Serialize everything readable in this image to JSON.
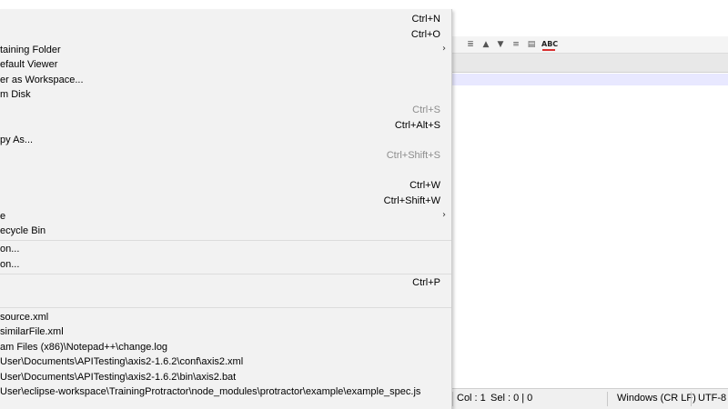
{
  "file_menu": {
    "items": [
      {
        "label": "",
        "shortcut": "Ctrl+N"
      },
      {
        "label": "",
        "shortcut": "Ctrl+O"
      },
      {
        "label": "taining Folder",
        "arrow": "›"
      },
      {
        "label": "efault Viewer"
      },
      {
        "label": "er as Workspace..."
      },
      {
        "label": "m Disk"
      },
      {
        "label": "",
        "shortcut": "Ctrl+S"
      },
      {
        "label": "",
        "shortcut": "Ctrl+Alt+S"
      },
      {
        "label": "py As..."
      },
      {
        "label": "",
        "shortcut": "Ctrl+Shift+S"
      },
      {
        "label": "",
        "shortcut": "Ctrl+W"
      },
      {
        "label": "",
        "shortcut": "Ctrl+Shift+W"
      },
      {
        "label": "e",
        "arrow": "›"
      },
      {
        "label": "ecycle Bin"
      },
      {
        "label": "on..."
      },
      {
        "label": "on..."
      },
      {
        "label": "",
        "shortcut": "Ctrl+P"
      },
      {
        "label": ""
      }
    ],
    "recent_files": [
      "source.xml",
      "similarFile.xml",
      "am Files (x86)\\Notepad++\\change.log",
      "User\\Documents\\APITesting\\axis2-1.6.2\\conf\\axis2.xml",
      "User\\Documents\\APITesting\\axis2-1.6.2\\bin\\axis2.bat",
      "User\\eclipse-workspace\\TrainingProtractor\\node_modules\\protractor\\example\\example_spec.js"
    ]
  },
  "toolbar": {
    "icons": [
      "align-left-icon",
      "arrow-up-icon",
      "arrow-down-icon",
      "list-icon",
      "panel-icon",
      "spell-check-icon"
    ],
    "spell_label": "ABC"
  },
  "statusbar": {
    "col": "Col : 1",
    "sel": "Sel : 0 | 0",
    "eol": "Windows (CR LF)",
    "encoding": "UTF-8"
  },
  "colors": {
    "menu_bg": "#f2f2f2",
    "current_line": "#e8e8ff",
    "statusbar_bg": "#f0f0f0"
  }
}
